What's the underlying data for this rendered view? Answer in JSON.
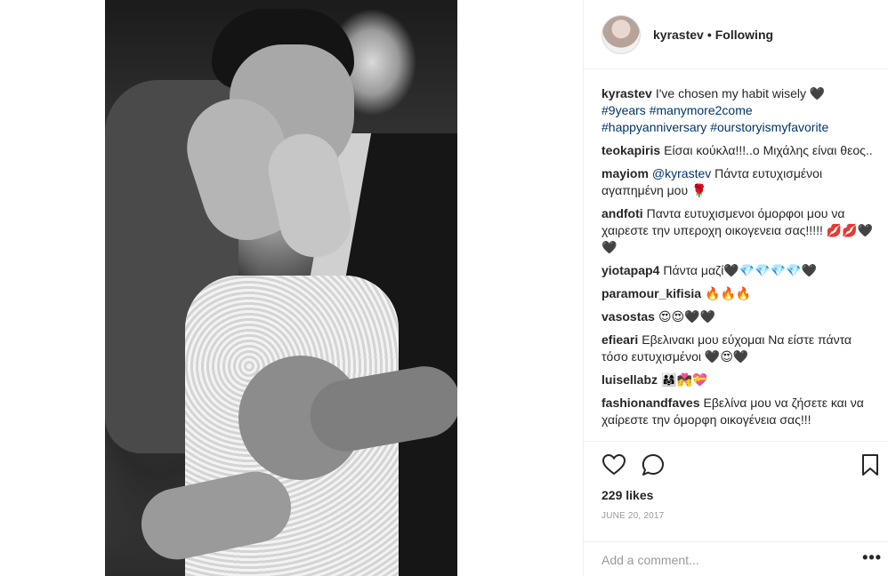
{
  "post": {
    "username": "kyrastev",
    "separator": "•",
    "follow_status": "Following"
  },
  "caption": {
    "user": "kyrastev",
    "text": "I've chosen my habit wisely 🖤",
    "tags": [
      "#9years",
      "#manymore2come",
      "#happyanniversary",
      "#ourstoryismyfavorite"
    ]
  },
  "comments": [
    {
      "user": "teokapiris",
      "text": "Είσαι κούκλα!!!..ο Μιχάλης είναι θεος.."
    },
    {
      "user": "mayiom",
      "mention": "@kyrastev",
      "text": "Πάντα ευτυχισμένοι αγαπημένη μου 🌹"
    },
    {
      "user": "andfoti",
      "text": "Παντα ευτυχισμενοι όμορφοι μου να χαιρεστε την υπεροχη οικογενεια σας!!!!! 💋💋🖤🖤"
    },
    {
      "user": "yiotapap4",
      "text": "Πάντα μαζί🖤💎💎💎💎🖤"
    },
    {
      "user": "paramour_kifisia",
      "text": "🔥🔥🔥"
    },
    {
      "user": "vasostas",
      "text": "😍😍🖤🖤"
    },
    {
      "user": "efieari",
      "text": "Εβελινακι μου εύχομαι Να είστε πάντα τόσο ευτυχισμένοι 🖤😍🖤"
    },
    {
      "user": "luisellabz",
      "text": "👨‍👩‍👧💏💝"
    },
    {
      "user": "fashionandfaves",
      "text": "Εβελίνα μου να ζήσετε και να χαίρεστε την όμορφη οικογένεια σας!!!"
    }
  ],
  "actions": {
    "icons": [
      "heart-icon",
      "comment-icon",
      "bookmark-icon"
    ],
    "likes": "229 likes",
    "date": "JUNE 20, 2017"
  },
  "add_comment": {
    "placeholder": "Add a comment...",
    "more": "•••"
  }
}
